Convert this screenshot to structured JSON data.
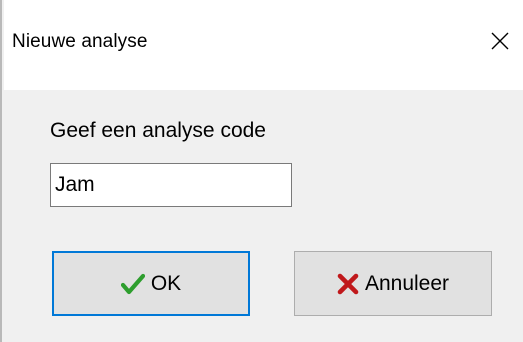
{
  "window": {
    "title": "Nieuwe analyse"
  },
  "form": {
    "prompt": "Geef een analyse code",
    "code_value": "Jam"
  },
  "buttons": {
    "ok_label": "OK",
    "cancel_label": "Annuleer"
  },
  "icons": {
    "close": "close-icon",
    "ok": "checkmark-icon",
    "cancel": "red-x-icon"
  },
  "colors": {
    "ok_icon": "#2e9e2e",
    "cancel_icon": "#c0181b",
    "focus_border": "#0078d7"
  }
}
